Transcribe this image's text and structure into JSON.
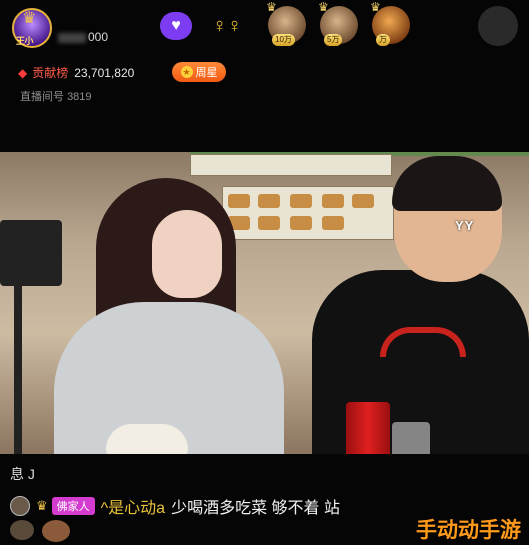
{
  "header": {
    "host_level_label": "王小",
    "host_name_suffix": "000",
    "follow_icon": "heart-icon",
    "share_icon": "people-icon",
    "viewers": [
      {
        "badge": "10万"
      },
      {
        "badge": "5万"
      },
      {
        "badge": "万"
      }
    ]
  },
  "stats": {
    "gift_label": "贡献榜",
    "gift_value": "23,701,820",
    "star_label": "周星",
    "room_label": "直播间号",
    "room_number": "3819"
  },
  "video": {
    "watermark": "YY"
  },
  "chat": {
    "top_line": "息 J",
    "badge": "佛家人",
    "username": "^是心动a",
    "message": "少喝酒多吃菜 够不着 站"
  },
  "overlay": {
    "site_watermark": "手动动手游"
  },
  "colors": {
    "accent_purple": "#7b3cf2",
    "star_orange": "#f25a12",
    "gift_red": "#ff5b4a",
    "family_pink": "#d43cd0",
    "username_gold": "#e9c23b"
  }
}
